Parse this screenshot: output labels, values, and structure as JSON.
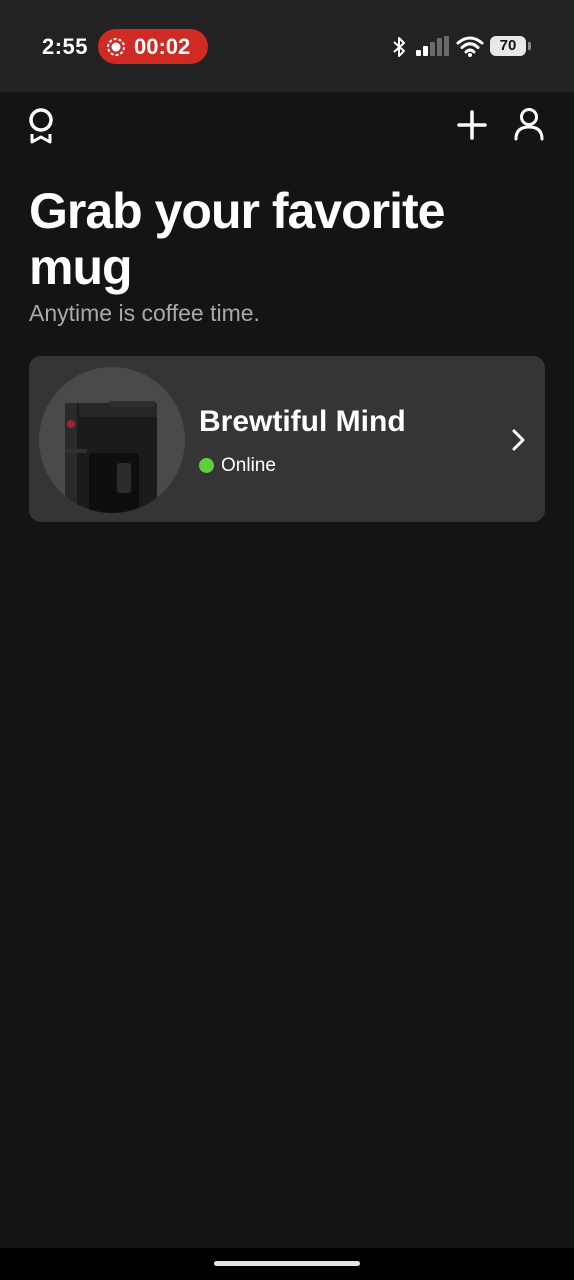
{
  "status_bar": {
    "time": "2:55",
    "recording_time": "00:02",
    "battery_level": "70",
    "colors": {
      "recording": "#d02a25"
    }
  },
  "header": {
    "logo_icon": "ribbon-badge-icon",
    "add_icon": "plus-icon",
    "profile_icon": "user-icon"
  },
  "main": {
    "headline": "Grab your favorite mug",
    "subheadline": "Anytime is coffee time."
  },
  "devices": [
    {
      "name": "Brewtiful Mind",
      "status": "Online",
      "status_color": "#5ad03c",
      "image": "coffee-maker-image"
    }
  ]
}
